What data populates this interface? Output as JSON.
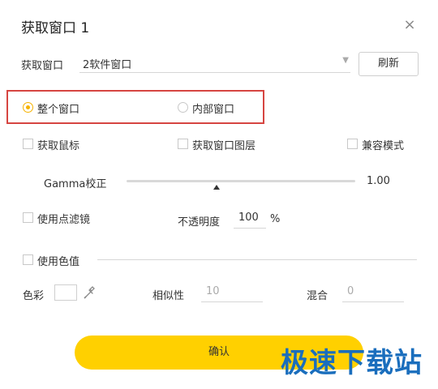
{
  "dialog": {
    "title": "获取窗口 1",
    "close_icon": "close-icon"
  },
  "capture_window": {
    "label": "获取窗口",
    "selected": "2软件窗口",
    "refresh_label": "刷新"
  },
  "mode": {
    "whole_window": "整个窗口",
    "inner_window": "内部窗口",
    "selected": "整个窗口",
    "accent_color": "#f5b200",
    "highlight_color": "#d64541"
  },
  "options": {
    "capture_mouse": "获取鼠标",
    "capture_window_layer": "获取窗口图层",
    "compat_mode": "兼容模式"
  },
  "gamma": {
    "label": "Gamma校正",
    "value": "1.00"
  },
  "point_filter": {
    "label": "使用点滤镜",
    "opacity_label": "不透明度",
    "opacity_value": "100",
    "opacity_unit": "%"
  },
  "color_key": {
    "label": "使用色值",
    "color_label": "色彩",
    "similarity_label": "相似性",
    "similarity_value": "10",
    "blend_label": "混合",
    "blend_value": "0"
  },
  "confirm_label": "确认",
  "watermark": "极速下载站",
  "colors": {
    "confirm_button": "#ffd000",
    "watermark": "#1a6ebd"
  }
}
